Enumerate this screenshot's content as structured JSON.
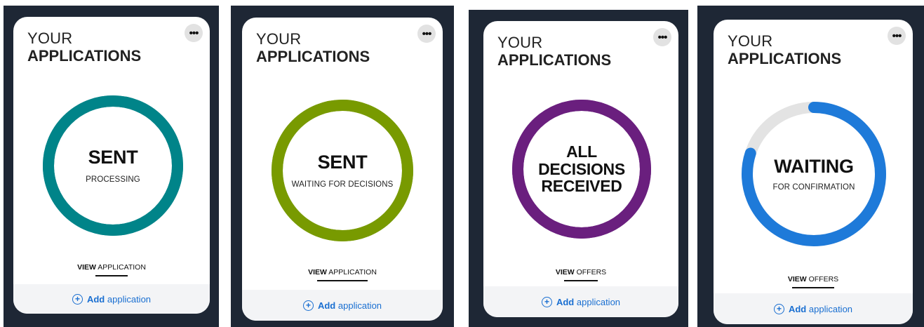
{
  "cards": [
    {
      "title_top": "YOUR",
      "title_main": "APPLICATIONS",
      "more_label": "•••",
      "ring_color": "#008489",
      "ring_progress": 1.0,
      "status_lines": [
        "SENT"
      ],
      "status_sub": "PROCESSING",
      "view_strong": "VIEW",
      "view_rest": "APPLICATION",
      "add_plus": "+",
      "add_strong": "Add",
      "add_rest": "application"
    },
    {
      "title_top": "YOUR",
      "title_main": "APPLICATIONS",
      "more_label": "•••",
      "ring_color": "#789a00",
      "ring_progress": 1.0,
      "status_lines": [
        "SENT"
      ],
      "status_sub": "WAITING FOR DECISIONS",
      "view_strong": "VIEW",
      "view_rest": "APPLICATION",
      "add_plus": "+",
      "add_strong": "Add",
      "add_rest": "application"
    },
    {
      "title_top": "YOUR",
      "title_main": "APPLICATIONS",
      "more_label": "•••",
      "ring_color": "#6a1f7e",
      "ring_progress": 1.0,
      "status_lines": [
        "ALL",
        "DECISIONS",
        "RECEIVED"
      ],
      "status_sub": "",
      "view_strong": "VIEW",
      "view_rest": "OFFERS",
      "add_plus": "+",
      "add_strong": "Add",
      "add_rest": "application"
    },
    {
      "title_top": "YOUR",
      "title_main": "APPLICATIONS",
      "more_label": "•••",
      "ring_color": "#1e7ad9",
      "ring_track_color": "#e3e3e3",
      "ring_progress": 0.8,
      "status_lines": [
        "WAITING"
      ],
      "status_sub": "FOR CONFIRMATION",
      "view_strong": "VIEW",
      "view_rest": "OFFERS",
      "add_plus": "+",
      "add_strong": "Add",
      "add_rest": "application"
    }
  ]
}
